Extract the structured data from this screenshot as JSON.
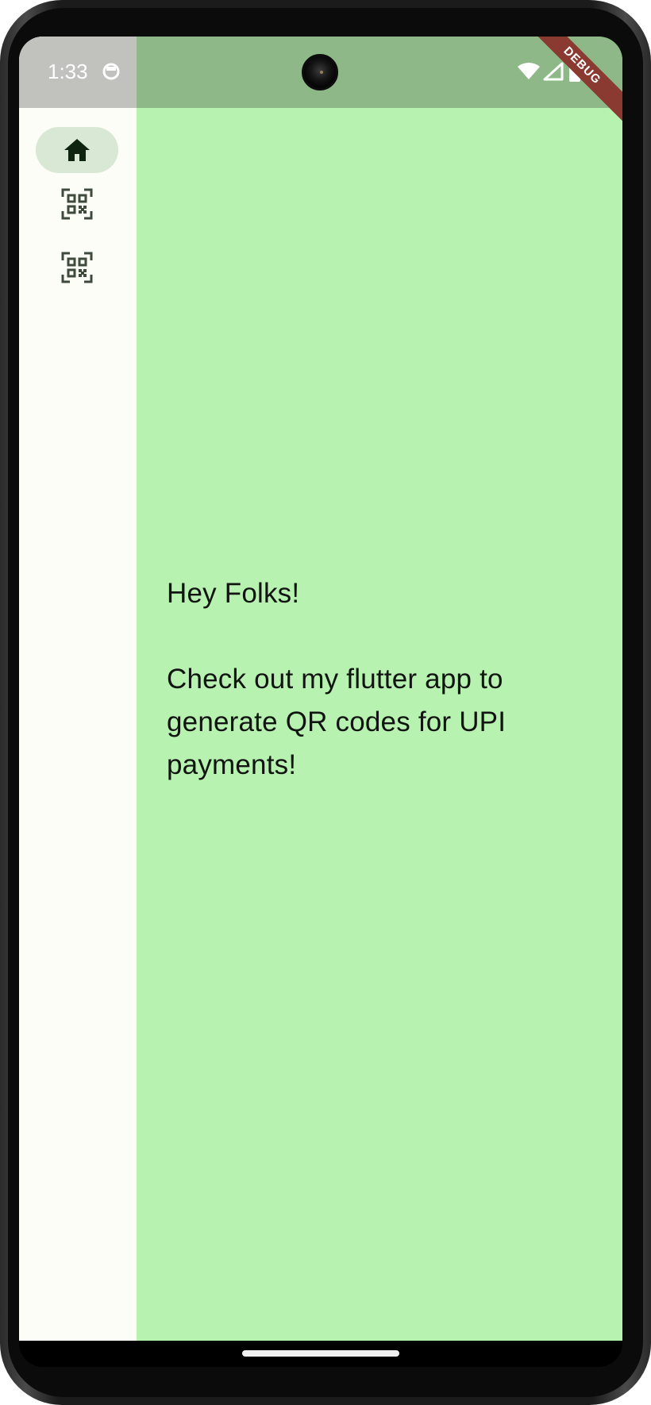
{
  "status_bar": {
    "time": "1:33",
    "notification_icon": "android-head-icon",
    "wifi_icon": "wifi-icon",
    "signal_icon": "cell-signal-icon",
    "battery_icon": "battery-icon"
  },
  "debug_banner": {
    "label": "DEBUG"
  },
  "navigation_rail": {
    "items": [
      {
        "icon": "home-icon",
        "selected": true
      },
      {
        "icon": "qr-code-scanner-icon",
        "selected": false
      },
      {
        "icon": "qr-code-scanner-icon",
        "selected": false
      }
    ]
  },
  "main": {
    "message": "Hey Folks!\n\nCheck out my flutter app to generate QR codes for UPI payments!"
  },
  "colors": {
    "content_background": "#b7f2b0",
    "rail_background": "#fcfdf7",
    "rail_selected_indicator": "#d9e8d4",
    "debug_banner": "#8a3a30"
  }
}
